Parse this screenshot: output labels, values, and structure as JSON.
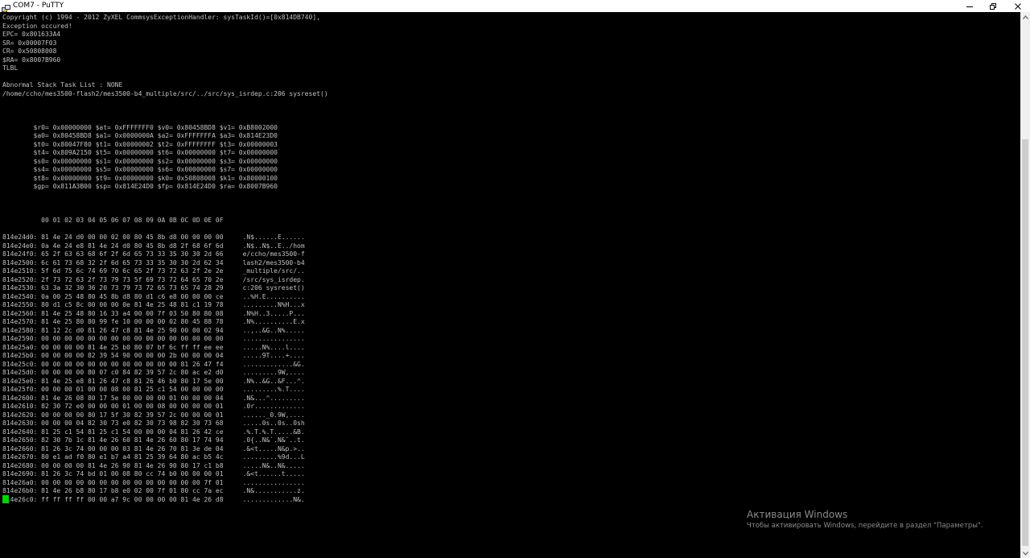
{
  "window": {
    "title": "COM7 - PuTTY",
    "icon": "putty-icon",
    "controls": [
      "minimize-icon",
      "maximize-icon",
      "close-icon"
    ]
  },
  "terminal": {
    "lines": [
      "Copyright (c) 1994 - 2012 ZyXEL CommsysExceptionHandler: sysTaskId()=[0x814DB740],",
      "Exception occured!",
      "EPC= 0x801633A4",
      "SR= 0x00007F03",
      "CR= 0x50808008",
      "$RA= 0x8007B960",
      "TLBL",
      "",
      "Abnormal Stack Task List : NONE",
      "/home/ccho/mes3500-flash2/mes3500-b4_multiple/src/../src/sys_isrdep.c:206 sysreset()",
      "",
      "",
      "",
      "        $r0= 0x00000000 $at= 0xFFFFFFF0 $v0= 0x80458BD8 $v1= 0xB8002000",
      "        $a0= 0x80458BD8 $a1= 0x0000000A $a2= 0xFFFFFFFA $a3= 0x814E23D0",
      "        $t0= 0x80047F80 $t1= 0x00000002 $t2= 0xFFFFFFFF $t3= 0x00000003",
      "        $t4= 0x809A2150 $t5= 0x00000000 $t6= 0x00000000 $t7= 0x00000000",
      "        $s0= 0x00000000 $s1= 0x00000000 $s2= 0x00000000 $s3= 0x00000000",
      "        $s4= 0x00000000 $s5= 0x00000000 $s6= 0x00000000 $s7= 0x00000000",
      "        $t8= 0x00000000 $t9= 0x00000000 $k0= 0x50808008 $k1= 0x80000100",
      "        $gp= 0x811A3B00 $sp= 0x814E24D0 $fp= 0x814E24D0 $ra= 0x8007B960",
      "",
      "",
      "",
      "          00 01 02 03 04 05 06 07 08 09 0A 0B 0C 0D 0E 0F",
      "",
      "814e24d0: 81 4e 24 d0 00 00 02 00 80 45 8b d8 00 00 00 00     .N$......E......",
      "814e24e0: 0a 4e 24 e8 81 4e 24 d0 80 45 8b d8 2f 68 6f 6d     .N$..N$..E../hom",
      "814e24f0: 65 2f 63 63 68 6f 2f 6d 65 73 33 35 30 30 2d 66     e/ccho/mes3500-f",
      "814e2500: 6c 61 73 68 32 2f 6d 65 73 33 35 30 30 2d 62 34     lash2/mes3500-b4",
      "814e2510: 5f 6d 75 6c 74 69 70 6c 65 2f 73 72 63 2f 2e 2e     _multiple/src/..",
      "814e2520: 2f 73 72 63 2f 73 79 73 5f 69 73 72 64 65 70 2e     /src/sys_isrdep.",
      "814e2530: 63 3a 32 30 36 20 73 79 73 72 65 73 65 74 28 29     c:206 sysreset()",
      "814e2540: 0a 00 25 48 80 45 8b d8 80 d1 c6 e8 00 00 00 ce     ..%H.E..........",
      "814e2550: 80 d1 c5 8c 00 00 00 0e 81 4e 25 48 81 c1 19 78     .........N%H...x",
      "814e2560: 81 4e 25 48 80 16 33 a4 00 00 7f 03 50 80 80 08     .N%H..3.....P...",
      "814e2570: 81 4e 25 80 80 99 fe 10 00 00 00 02 80 45 88 78     .N%..........E.x",
      "814e2580: 81 12 2c d0 81 26 47 c8 81 4e 25 90 00 00 02 94     ..,..&G..N%.....",
      "814e2590: 00 00 00 00 00 00 00 00 00 00 00 00 00 00 00 00     ................",
      "814e25a0: 00 00 00 00 81 4e 25 b0 80 07 bf 6c ff ff ee ee     .....N%....l....",
      "814e25b0: 00 00 00 00 82 39 54 90 00 00 00 2b 00 00 00 04     .....9T....+....",
      "814e25c0: 00 00 00 00 00 00 00 00 00 00 00 00 81 26 47 f4     .............&G.",
      "814e25d0: 00 00 00 00 80 07 c0 84 82 39 57 2c 80 ac e2 d0     .........9W,....",
      "814e25e0: 81 4e 25 e8 81 26 47 c8 81 26 46 b0 80 17 5e 00     .N%..&G..&F...^.",
      "814e25f0: 00 00 00 01 00 00 08 00 81 25 c1 54 00 00 00 00     .........%.T....",
      "814e2600: 81 4e 26 08 80 17 5e 00 00 00 00 01 00 00 00 04     .N&...^.........",
      "814e2610: 82 30 72 e0 00 00 00 01 00 00 08 00 00 00 00 01     .0r.............",
      "814e2620: 00 00 00 00 80 17 5f 30 82 39 57 2c 00 00 00 01     ......_0.9W,....",
      "814e2630: 00 00 00 04 82 30 73 e0 82 30 73 98 82 30 73 68     .....0s..0s..0sh",
      "814e2640: 81 25 c1 54 81 25 c1 54 00 00 00 04 81 26 42 ce     .%.T.%.T.....&B.",
      "814e2650: 82 30 7b 1c 81 4e 26 60 81 4e 26 60 80 17 74 94     .0{..N&`.N&`..t.",
      "814e2660: 81 26 3c 74 00 00 00 03 81 4e 26 70 81 3e de 04     .&<t.....N&p.>..",
      "814e2670: 80 e1 ad f0 80 e1 b7 a4 81 25 39 64 80 ac b5 4c     .........%9d...L",
      "814e2680: 00 00 00 00 81 4e 26 90 81 4e 26 90 80 17 c1 b8     .....N&..N&.....",
      "814e2690: 81 26 3c 74 bd 01 00 08 80 cc 74 b0 00 00 00 01     .&<t......t.....",
      "814e26a0: 00 00 00 00 00 00 00 00 00 00 00 00 00 00 7f 01     ................",
      "814e26b0: 81 4e 26 b8 80 17 b8 e0 02 00 7f 01 80 cc 7a ec     .N&...........z.",
      "814e26c0: ff ff ff ff 00 00 a7 9c 00 00 00 00 81 4e 26 d8     .............N&."
    ]
  },
  "activation": {
    "title": "Активация Windows",
    "subtitle": "Чтобы активировать Windows, перейдите в раздел \"Параметры\"."
  }
}
